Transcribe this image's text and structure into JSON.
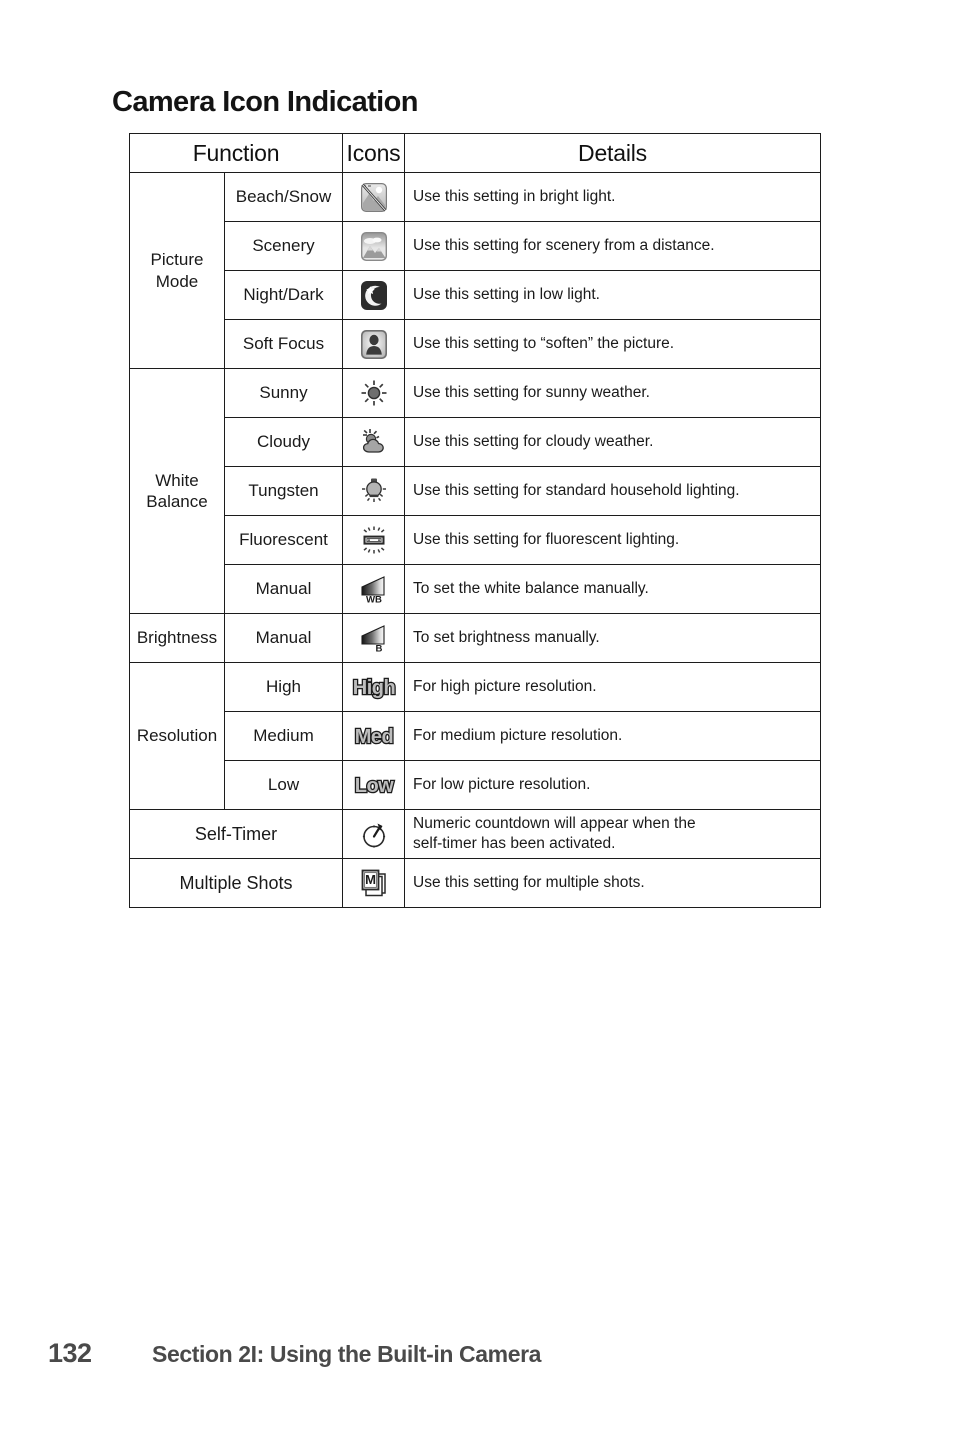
{
  "document": {
    "title": "Camera Icon Indication"
  },
  "table": {
    "headers": {
      "function": "Function",
      "icons": "Icons",
      "details": "Details"
    },
    "groups": [
      {
        "name": "Picture\nMode",
        "name_line1": "Picture",
        "name_line2": "Mode",
        "rows": [
          {
            "label": "Beach/Snow",
            "icon": "beach-snow-icon",
            "details": "Use this setting in bright light."
          },
          {
            "label": "Scenery",
            "icon": "scenery-icon",
            "details": "Use this setting for scenery from a distance."
          },
          {
            "label": "Night/Dark",
            "icon": "night-dark-icon",
            "details": "Use this setting in low light."
          },
          {
            "label": "Soft Focus",
            "icon": "soft-focus-icon",
            "details": "Use this setting to “soften” the picture."
          }
        ]
      },
      {
        "name": "White\nBalance",
        "name_line1": "White",
        "name_line2": "Balance",
        "rows": [
          {
            "label": "Sunny",
            "icon": "sunny-icon",
            "details": "Use this setting for sunny weather."
          },
          {
            "label": "Cloudy",
            "icon": "cloudy-icon",
            "details": "Use this setting for cloudy weather."
          },
          {
            "label": "Tungsten",
            "icon": "tungsten-icon",
            "details": "Use this setting for standard household lighting."
          },
          {
            "label": "Fluorescent",
            "icon": "fluorescent-icon",
            "details": "Use this setting for fluorescent lighting."
          },
          {
            "label": "Manual",
            "icon": "manual-white-balance-icon",
            "details": "To set the white balance manually."
          }
        ]
      },
      {
        "name": "Brightness",
        "name_line1": "Brightness",
        "name_line2": "",
        "rows": [
          {
            "label": "Manual",
            "icon": "manual-brightness-icon",
            "details": "To set brightness manually."
          }
        ]
      },
      {
        "name": "Resolution",
        "name_line1": "Resolution",
        "name_line2": "",
        "rows": [
          {
            "label": "High",
            "icon": "high-resolution-icon",
            "icon_text": "High",
            "details": "For high picture resolution."
          },
          {
            "label": "Medium",
            "icon": "medium-resolution-icon",
            "icon_text": "Med",
            "details": "For medium picture resolution."
          },
          {
            "label": "Low",
            "icon": "low-resolution-icon",
            "icon_text": "Low",
            "details": "For low picture resolution."
          }
        ]
      }
    ],
    "single_rows": [
      {
        "label": "Self-Timer",
        "icon": "self-timer-icon",
        "details_line1": "Numeric countdown will appear when the",
        "details_line2": "self-timer has been activated."
      },
      {
        "label": "Multiple Shots",
        "icon": "multiple-shots-icon",
        "details_line1": "Use this setting for multiple shots.",
        "details_line2": ""
      }
    ]
  },
  "footer": {
    "page_number": "132",
    "section": "Section 2I: Using the Built-in Camera"
  },
  "colors": {
    "text": "#1a1a1a",
    "footer_text": "#4a4a4a",
    "border": "#1c1c1c",
    "header_rule": "#111111"
  }
}
